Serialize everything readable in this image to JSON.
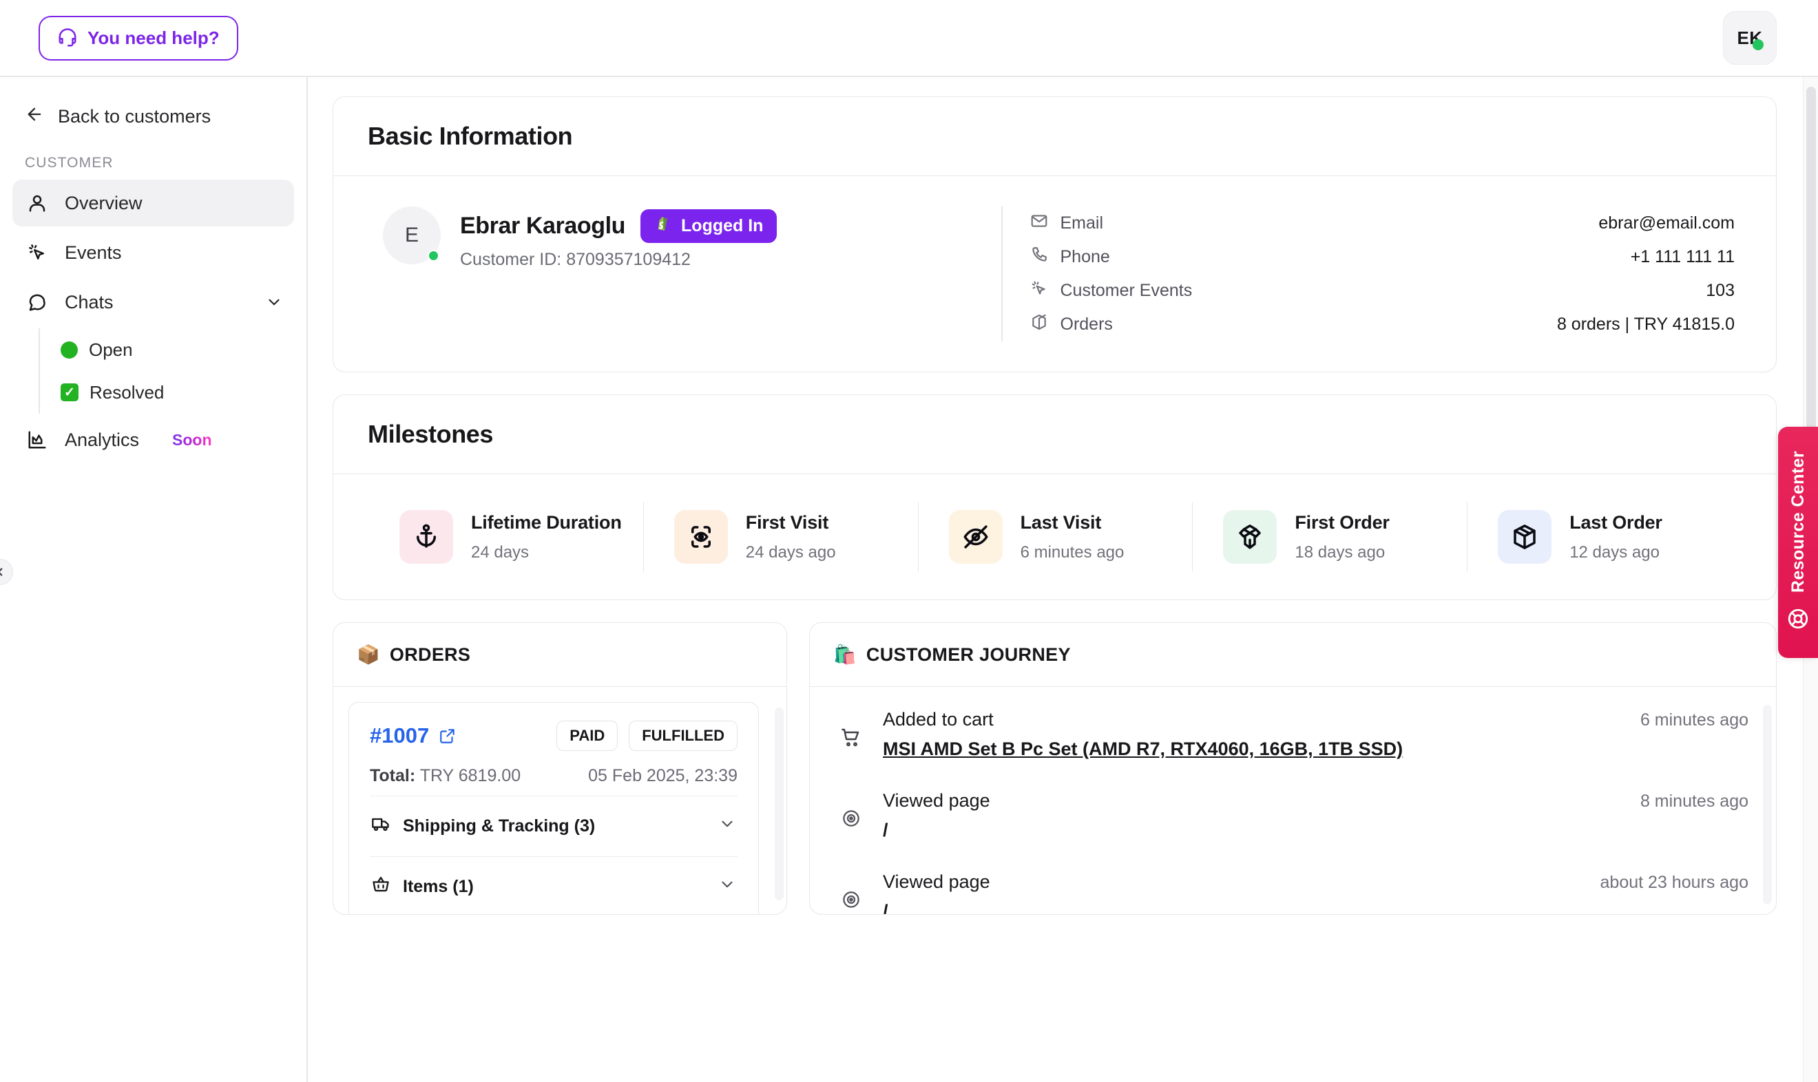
{
  "topbar": {
    "help_button": "You need help?",
    "help_icon": "headset-icon",
    "avatar_initials": "EK",
    "avatar_presence": "online"
  },
  "sidebar": {
    "back_label": "Back to customers",
    "section_label": "CUSTOMER",
    "items": [
      {
        "label": "Overview",
        "icon": "user-icon",
        "active": true
      },
      {
        "label": "Events",
        "icon": "cursor-click-icon",
        "active": false
      },
      {
        "label": "Chats",
        "icon": "chat-bubble-icon",
        "active": false,
        "expanded": true
      }
    ],
    "chat_children": [
      {
        "label": "Open",
        "icon": "green-circle-icon"
      },
      {
        "label": "Resolved",
        "icon": "green-check-box-icon"
      }
    ],
    "analytics": {
      "label": "Analytics",
      "icon": "analytics-chart-icon",
      "badge": "Soon"
    }
  },
  "basic_information": {
    "title": "Basic Information",
    "avatar_letter": "E",
    "name": "Ebrar Karaoglu",
    "badge": {
      "label": "Logged In",
      "icon": "shopify-bag-icon",
      "color": "#7b24ee"
    },
    "customer_id": "Customer ID: 8709357109412",
    "details": [
      {
        "icon": "mail-icon",
        "label": "Email",
        "value": "ebrar@email.com"
      },
      {
        "icon": "phone-icon",
        "label": "Phone",
        "value": "+1 111 111 11"
      },
      {
        "icon": "cursor-click-icon",
        "label": "Customer Events",
        "value": "103"
      },
      {
        "icon": "box-icon",
        "label": "Orders",
        "value": "8 orders | TRY 41815.0"
      }
    ]
  },
  "milestones": {
    "title": "Milestones",
    "items": [
      {
        "icon": "anchor-icon",
        "bg": "#fce7ec",
        "title": "Lifetime Duration",
        "value": "24 days"
      },
      {
        "icon": "eye-scan-icon",
        "bg": "#fdeee0",
        "title": "First Visit",
        "value": "24 days ago"
      },
      {
        "icon": "eye-off-icon",
        "bg": "#fdf3e0",
        "title": "Last Visit",
        "value": "6 minutes ago"
      },
      {
        "icon": "package-open-icon",
        "bg": "#e6f6ec",
        "title": "First Order",
        "value": "18 days ago"
      },
      {
        "icon": "package-icon",
        "bg": "#e9eefc",
        "title": "Last Order",
        "value": "12 days ago"
      }
    ]
  },
  "orders": {
    "heading": "ORDERS",
    "heading_icon": "package-emoji",
    "list": [
      {
        "number": "#1007",
        "external_link_icon": "external-link-icon",
        "status_payment": "PAID",
        "status_fulfillment": "FULFILLED",
        "total_label": "Total:",
        "total_value": "TRY 6819.00",
        "date": "05 Feb 2025, 23:39",
        "accordions": [
          {
            "icon": "truck-icon",
            "label": "Shipping & Tracking (3)",
            "chevron": "chevron-down-icon"
          },
          {
            "icon": "basket-icon",
            "label": "Items (1)",
            "chevron": "chevron-down-icon"
          }
        ]
      }
    ]
  },
  "customer_journey": {
    "heading": "CUSTOMER JOURNEY",
    "heading_icon": "shopping-bags-emoji",
    "events": [
      {
        "icon": "cart-icon",
        "title": "Added to cart",
        "detail": "MSI AMD Set B Pc Set (AMD R7, RTX4060, 16GB, 1TB SSD)",
        "detail_is_link": true,
        "time": "6 minutes ago"
      },
      {
        "icon": "eye-target-icon",
        "title": "Viewed page",
        "detail": "/",
        "detail_is_link": false,
        "time": "8 minutes ago"
      },
      {
        "icon": "eye-target-icon",
        "title": "Viewed page",
        "detail": "/",
        "detail_is_link": false,
        "time": "about 23 hours ago"
      }
    ]
  },
  "resource_center": {
    "label": "Resource Center",
    "icon": "lifebuoy-icon",
    "color": "#e8275c"
  }
}
